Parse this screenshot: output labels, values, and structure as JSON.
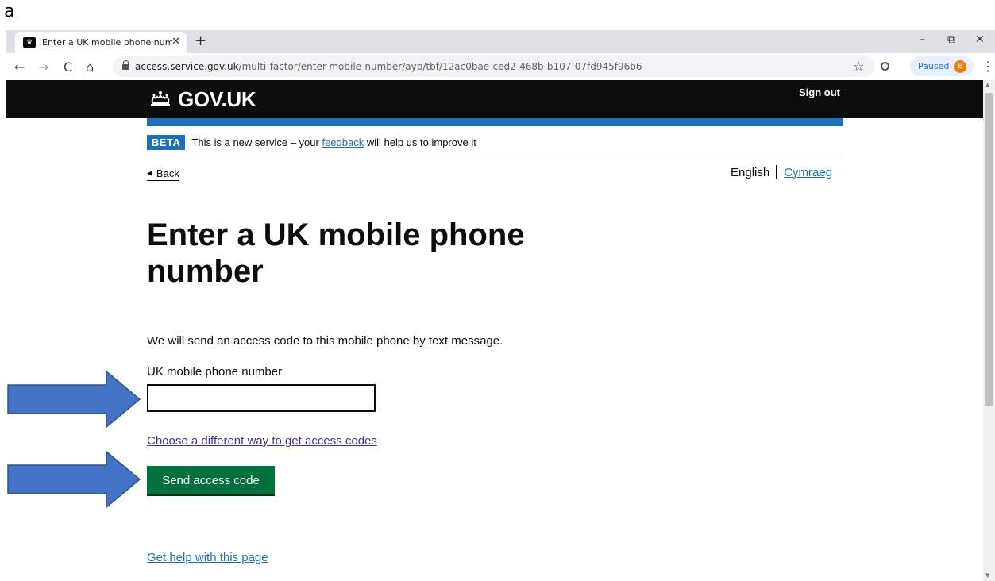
{
  "figure": {
    "caption_letter": "a"
  },
  "browser": {
    "tab_title": "Enter a UK mobile phone numbe",
    "tab_close": "✕",
    "new_tab": "+",
    "window_controls": {
      "minimize": "–",
      "restore": "⧉",
      "close": "✕"
    },
    "url_host": "access.service.gov.uk",
    "url_path": "/multi-factor/enter-mobile-number/ayp/tbf/12ac0bae-ced2-468b-b107-07fd945f96b6",
    "profile_status": "Paused",
    "profile_initial": "B",
    "nav": {
      "back": "←",
      "forward": "→",
      "reload": "C",
      "home": "⌂",
      "star": "☆",
      "menu": "⋮"
    },
    "icons": [
      "gov-favicon-icon",
      "lock-icon",
      "star-icon",
      "extension-icon",
      "menu-icon"
    ]
  },
  "header": {
    "logo_text": "GOV.UK",
    "sign_out": "Sign out",
    "colors": {
      "background": "#0b0c0c",
      "accent_bar": "#1d70b8"
    }
  },
  "phase_banner": {
    "tag": "BETA",
    "text_before": "This is a new service – your ",
    "link": "feedback",
    "text_after": " will help us to improve it"
  },
  "navigation": {
    "back": "Back",
    "language_current": "English",
    "language_other": "Cymraeg"
  },
  "main": {
    "title": "Enter a UK mobile phone number",
    "hint": "We will send an access code to this mobile phone by text message.",
    "field_label": "UK mobile phone number",
    "field_value": "",
    "alternative_link": "Choose a different way to get access codes",
    "submit_button": "Send access code",
    "help_link": "Get help with this page",
    "colors": {
      "button": "#00703c",
      "link": "#1d70b8",
      "visited_link": "#4c2c92"
    }
  },
  "annotations": {
    "arrow_color": "#4472c4"
  }
}
